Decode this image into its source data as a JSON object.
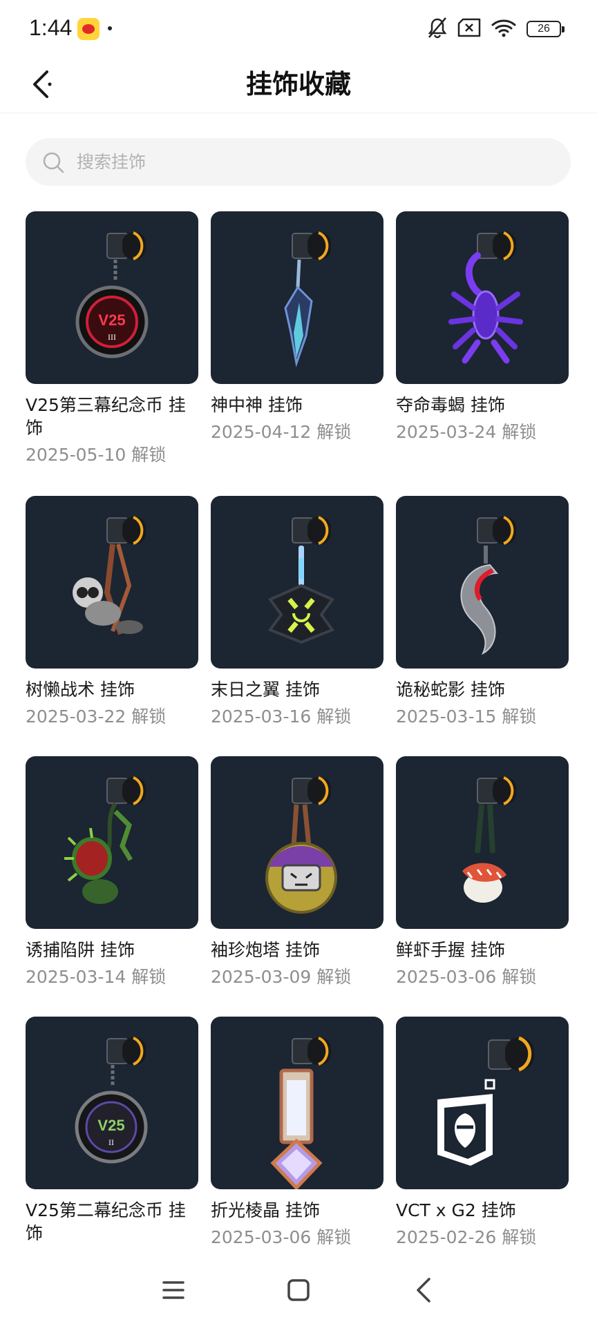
{
  "status_bar": {
    "time": "1:44",
    "battery": "26",
    "icons": [
      "app-notification-icon",
      "bell-off-icon",
      "sim-blocked-icon",
      "wifi-icon",
      "battery-icon"
    ]
  },
  "header": {
    "title": "挂饰收藏",
    "back_icon": "back-arrow-icon"
  },
  "search": {
    "placeholder": "搜索挂饰",
    "value": "",
    "icon": "search-icon"
  },
  "items": [
    {
      "name": "V25第三幕纪念币 挂饰",
      "date": "2025-05-10 解锁",
      "art": "coin-red"
    },
    {
      "name": "神中神 挂饰",
      "date": "2025-04-12 解锁",
      "art": "blade"
    },
    {
      "name": "夺命毒蝎 挂饰",
      "date": "2025-03-24 解锁",
      "art": "scorpion"
    },
    {
      "name": "树懒战术 挂饰",
      "date": "2025-03-22 解锁",
      "art": "sloth"
    },
    {
      "name": "末日之翼 挂饰",
      "date": "2025-03-16 解锁",
      "art": "wing"
    },
    {
      "name": "诡秘蛇影 挂饰",
      "date": "2025-03-15 解锁",
      "art": "snake"
    },
    {
      "name": "诱捕陷阱 挂饰",
      "date": "2025-03-14 解锁",
      "art": "flytrap"
    },
    {
      "name": "袖珍炮塔 挂饰",
      "date": "2025-03-09 解锁",
      "art": "turret"
    },
    {
      "name": "鲜虾手握 挂饰",
      "date": "2025-03-06 解锁",
      "art": "sushi"
    },
    {
      "name": "V25第二幕纪念币 挂饰",
      "date": "",
      "art": "coin-dark"
    },
    {
      "name": "折光棱晶 挂饰",
      "date": "2025-03-06 解锁",
      "art": "prism"
    },
    {
      "name": "VCT x G2 挂饰",
      "date": "2025-02-26 解锁",
      "art": "g2"
    }
  ],
  "nav": {
    "icons": [
      "menu-icon",
      "home-square-icon",
      "back-chevron-icon"
    ]
  }
}
